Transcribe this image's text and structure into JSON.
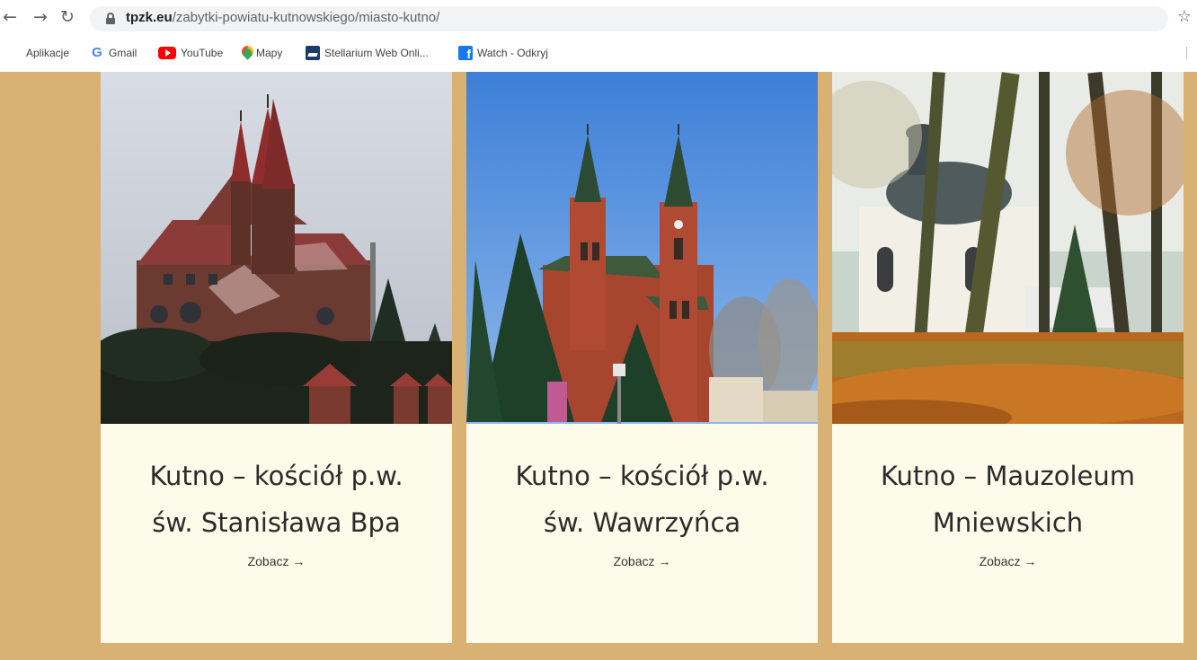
{
  "browser": {
    "url_host": "tpzk.eu",
    "url_path": "/zabytki-powiatu-kutnowskiego/miasto-kutno/",
    "icons": {
      "back": "back-arrow-icon",
      "forward": "forward-arrow-icon",
      "reload": "reload-icon",
      "lock": "lock-icon",
      "star": "bookmark-star-icon"
    }
  },
  "bookmarks": {
    "items": [
      {
        "label": "Aplikacje",
        "icon": "apps-grid-icon"
      },
      {
        "label": "Gmail",
        "icon": "google-icon"
      },
      {
        "label": "YouTube",
        "icon": "youtube-icon"
      },
      {
        "label": "Mapy",
        "icon": "maps-pin-icon"
      },
      {
        "label": "Stellarium Web Onli...",
        "icon": "stellarium-icon"
      },
      {
        "label": "Watch - Odkryj",
        "icon": "facebook-icon"
      }
    ]
  },
  "cards": [
    {
      "title_line1": "Kutno – kościół p.w.",
      "title_line2": "św. Stanisława Bpa",
      "link": "Zobacz →",
      "image": "red-brick church with twin spires under overcast sky"
    },
    {
      "title_line1": "Kutno – kościół p.w.",
      "title_line2": "św. Wawrzyńca",
      "link": "Zobacz →",
      "image": "gothic red-brick church with two towers under blue sky"
    },
    {
      "title_line1": "Kutno – Mauzoleum",
      "title_line2": "Mniewskich",
      "link": "Zobacz →",
      "image": "white domed mausoleum among autumn trees"
    }
  ],
  "colors": {
    "page_bg": "#d9b273",
    "card_bg": "#fdfbea",
    "title_text": "#2b2b2b"
  }
}
